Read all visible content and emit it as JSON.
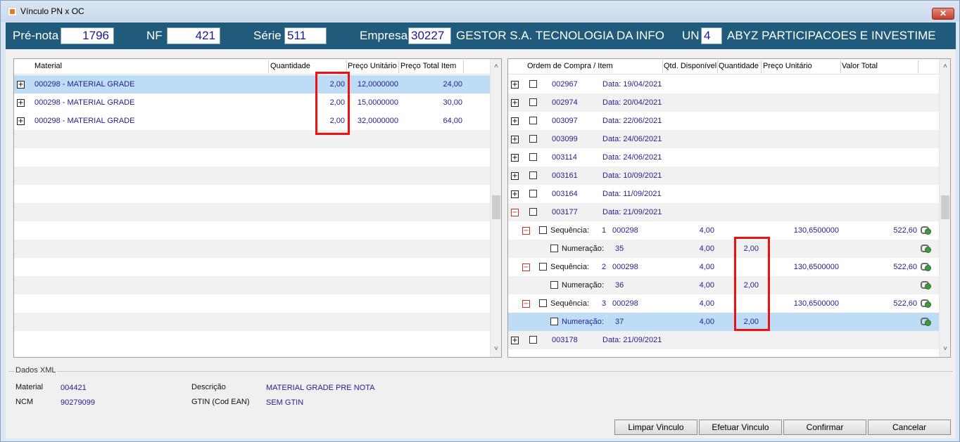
{
  "window": {
    "title": "Vínculo PN x OC",
    "close_label": "✕"
  },
  "header": {
    "prenota_label": "Pré-nota",
    "prenota_value": "1796",
    "nf_label": "NF",
    "nf_value": "421",
    "serie_label": "Série",
    "serie_value": "511",
    "empresa_label": "Empresa",
    "empresa_value": "30227",
    "empresa_name": "GESTOR S.A. TECNOLOGIA DA INFO",
    "un_label": "UN",
    "un_value": "4",
    "un_name": "ABYZ PARTICIPACOES E INVESTIME"
  },
  "left_grid": {
    "columns": [
      "Material",
      "Quantidade",
      "Preço Unitário",
      "Preço Total Item"
    ],
    "rows": [
      {
        "material": "000298 - MATERIAL GRADE",
        "quantidade": "2,00",
        "preco_unitario": "12,0000000",
        "preco_total": "24,00"
      },
      {
        "material": "000298 - MATERIAL GRADE",
        "quantidade": "2,00",
        "preco_unitario": "15,0000000",
        "preco_total": "30,00"
      },
      {
        "material": "000298 - MATERIAL GRADE",
        "quantidade": "2,00",
        "preco_unitario": "32,0000000",
        "preco_total": "64,00"
      }
    ]
  },
  "right_grid": {
    "columns": [
      "Ordem de Compra / Item",
      "Qtd. Disponível",
      "Quantidade",
      "Preço Unitário",
      "Valor Total"
    ],
    "orders": [
      {
        "code": "002967",
        "date": "Data: 19/04/2021"
      },
      {
        "code": "002974",
        "date": "Data: 20/04/2021"
      },
      {
        "code": "003097",
        "date": "Data: 22/06/2021"
      },
      {
        "code": "003099",
        "date": "Data: 24/06/2021"
      },
      {
        "code": "003114",
        "date": "Data: 24/06/2021"
      },
      {
        "code": "003161",
        "date": "Data: 10/09/2021"
      },
      {
        "code": "003164",
        "date": "Data: 11/09/2021"
      },
      {
        "code": "003177",
        "date": "Data: 21/09/2021"
      }
    ],
    "sub_rows": [
      {
        "label": "Sequência:",
        "num": "1",
        "material": "000298",
        "qtd_disp": "4,00",
        "quantidade": "",
        "preco": "130,6500000",
        "valor": "522,60"
      },
      {
        "label": "Numeração:",
        "num": "35",
        "material": "",
        "qtd_disp": "4,00",
        "quantidade": "2,00",
        "preco": "",
        "valor": ""
      },
      {
        "label": "Sequência:",
        "num": "2",
        "material": "000298",
        "qtd_disp": "4,00",
        "quantidade": "",
        "preco": "130,6500000",
        "valor": "522,60"
      },
      {
        "label": "Numeração:",
        "num": "36",
        "material": "",
        "qtd_disp": "4,00",
        "quantidade": "2,00",
        "preco": "",
        "valor": ""
      },
      {
        "label": "Sequência:",
        "num": "3",
        "material": "000298",
        "qtd_disp": "4,00",
        "quantidade": "",
        "preco": "130,6500000",
        "valor": "522,60"
      },
      {
        "label": "Numeração:",
        "num": "37",
        "material": "",
        "qtd_disp": "4,00",
        "quantidade": "2,00",
        "preco": "",
        "valor": ""
      }
    ],
    "last_order": {
      "code": "003178",
      "date": "Data: 21/09/2021"
    }
  },
  "xml": {
    "group_title": "Dados XML",
    "material_label": "Material",
    "material_value": "004421",
    "ncm_label": "NCM",
    "ncm_value": "90279099",
    "descricao_label": "Descrição",
    "descricao_value": "MATERIAL GRADE PRE NOTA",
    "gtin_label": "GTIN (Cod EAN)",
    "gtin_value": "SEM GTIN"
  },
  "buttons": {
    "limpar": "Limpar Vinculo",
    "efetuar": "Efetuar Vinculo",
    "confirmar": "Confirmar",
    "cancelar": "Cancelar"
  },
  "icons": {
    "expand": "plus-icon",
    "collapse": "minus-icon",
    "link": "link-icon"
  },
  "colors": {
    "header_bg": "#215b7c",
    "selected_row": "#bfdcf6",
    "value_text": "#1f1f8f",
    "highlight_box": "#e11111"
  }
}
